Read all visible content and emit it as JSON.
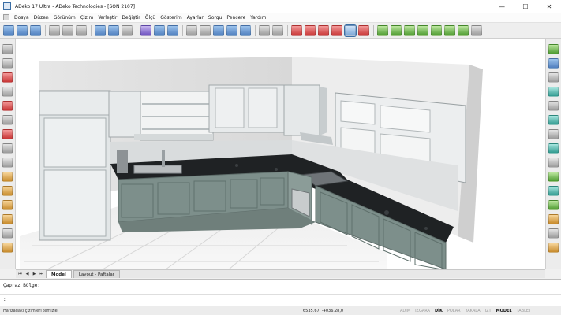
{
  "window": {
    "title": "ADeko 17 Ultra - ADeko Technologies - [SON 2107]",
    "controls": [
      "—",
      "☐",
      "✕"
    ]
  },
  "menu": {
    "items": [
      "Dosya",
      "Düzen",
      "Görünüm",
      "Çizim",
      "Yerleştir",
      "Değiştir",
      "Ölçü",
      "Gösterim",
      "Ayarlar",
      "Sorgu",
      "Pencere",
      "Yardım"
    ]
  },
  "tabs": {
    "items": [
      "Model",
      "Layout - Paftalar"
    ],
    "active": "Model"
  },
  "command": {
    "history": "Çapraz Bölge:",
    "prompt": ":"
  },
  "status": {
    "message": "Hafızadaki çizimleri temizle",
    "coordinates": "6535.67, -4036.28,0",
    "toggles": [
      {
        "label": "ADIM",
        "on": false
      },
      {
        "label": "IZGARA",
        "on": false
      },
      {
        "label": "DİK",
        "on": true
      },
      {
        "label": "POLAR",
        "on": false
      },
      {
        "label": "YAKALA",
        "on": false
      },
      {
        "label": "IZT",
        "on": false
      },
      {
        "label": "MODEL",
        "on": true
      },
      {
        "label": "TABLET",
        "on": false
      }
    ]
  }
}
